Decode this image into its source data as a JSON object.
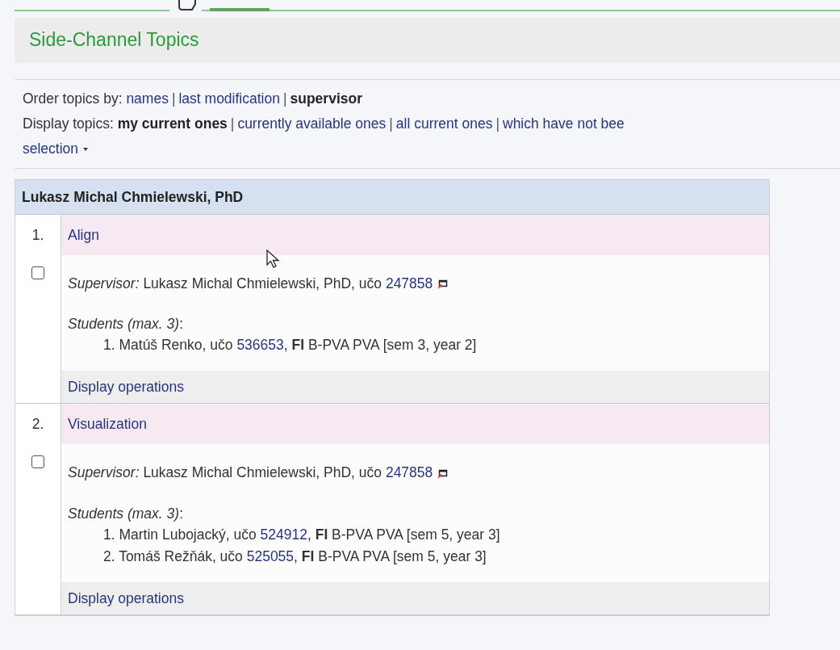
{
  "title": "Side-Channel Topics",
  "order": {
    "label": "Order topics by:",
    "separator": "|",
    "options": [
      {
        "label": "names",
        "selected": false
      },
      {
        "label": "last modification",
        "selected": false
      },
      {
        "label": "supervisor",
        "selected": true
      }
    ]
  },
  "display": {
    "label": "Display topics:",
    "separator": "|",
    "options": [
      {
        "label": "my current ones",
        "selected": true
      },
      {
        "label": "currently available ones",
        "selected": false
      },
      {
        "label": "all current ones",
        "selected": false
      },
      {
        "label": "which have not bee",
        "selected": false
      }
    ]
  },
  "selection": {
    "label": "selection"
  },
  "group": {
    "header": "Lukasz Michal Chmielewski, PhD",
    "topics": [
      {
        "number": "1.",
        "title": "Align",
        "checked": false,
        "supervisor_label": "Supervisor:",
        "supervisor": "Lukasz Michal Chmielewski, PhD, učo",
        "supervisor_uco": "247858",
        "students_label": "*Students (max. 3)*:",
        "students": [
          {
            "prefix": "1. Matúš Renko, učo",
            "uco": "536653",
            "rest": ", **FI** B-PVA PVA [sem 3, year 2]"
          }
        ],
        "operations": "Display operations"
      },
      {
        "number": "2.",
        "title": "Visualization",
        "checked": false,
        "supervisor_label": "Supervisor:",
        "supervisor": "Lukasz Michal Chmielewski, PhD, učo",
        "supervisor_uco": "247858",
        "students_label": "*Students (max. 3)*:",
        "students": [
          {
            "prefix": "1. Martin Lubojacký, učo",
            "uco": "524912",
            "rest": ", **FI** B-PVA PVA [sem 5, year 3]"
          },
          {
            "prefix": "2. Tomáš Režňák, učo",
            "uco": "525055",
            "rest": ", **FI** B-PVA PVA [sem 5, year 3]"
          }
        ],
        "operations": "Display operations"
      }
    ]
  }
}
